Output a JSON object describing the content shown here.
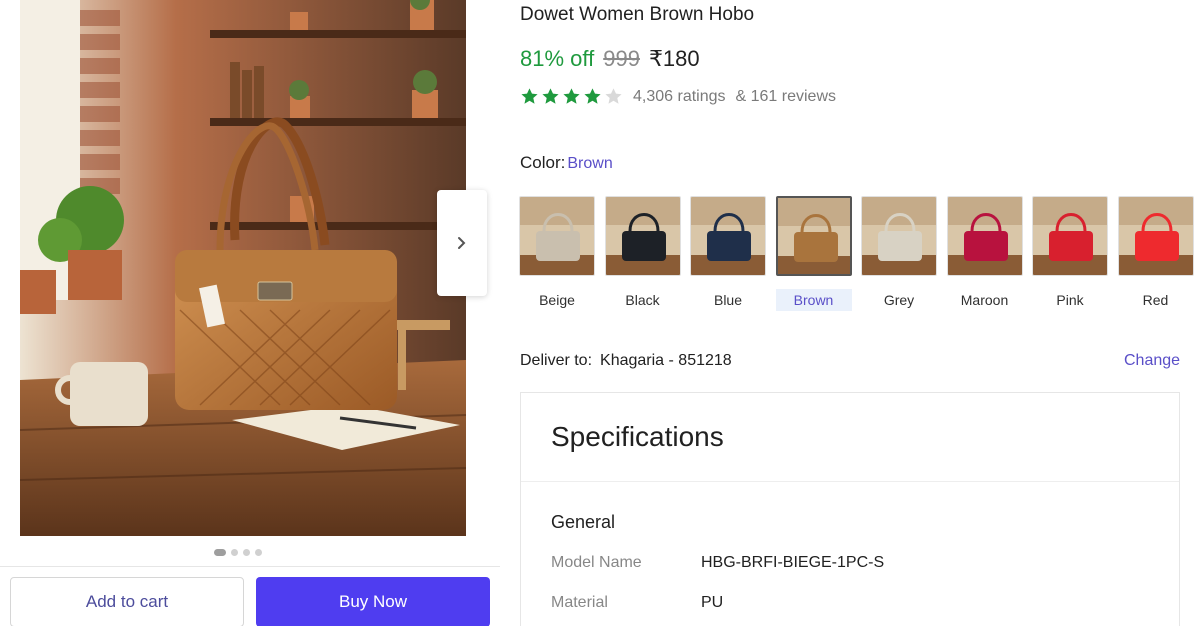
{
  "product": {
    "title": "Dowet Women Brown Hobo",
    "discount": "81% off",
    "mrp": "999",
    "price": "₹180",
    "rating_stars": 4,
    "ratings_text": "4,306 ratings",
    "reviews_text": "& 161 reviews"
  },
  "color": {
    "label": "Color:",
    "selected": "Brown",
    "swatches": [
      {
        "name": "Beige",
        "hex": "#c9bfae"
      },
      {
        "name": "Black",
        "hex": "#1d2127"
      },
      {
        "name": "Blue",
        "hex": "#1f2f4a"
      },
      {
        "name": "Brown",
        "hex": "#a9743d"
      },
      {
        "name": "Grey",
        "hex": "#d8d2c4"
      },
      {
        "name": "Maroon",
        "hex": "#b8123e"
      },
      {
        "name": "Pink",
        "hex": "#d8202e"
      },
      {
        "name": "Red",
        "hex": "#ee2a2e"
      }
    ]
  },
  "delivery": {
    "label": "Deliver to:",
    "location": "Khagaria - 851218",
    "change_label": "Change"
  },
  "specifications": {
    "title": "Specifications",
    "group": "General",
    "rows": [
      {
        "key": "Model Name",
        "value": "HBG-BRFI-BIEGE-1PC-S"
      },
      {
        "key": "Material",
        "value": "PU"
      }
    ]
  },
  "actions": {
    "add_to_cart": "Add to cart",
    "buy_now": "Buy Now"
  },
  "gallery": {
    "image_count": 4,
    "active_index": 0
  },
  "colors": {
    "discount_green": "#1f9a3e",
    "accent": "#4f3df0",
    "link": "#5a4fc8",
    "star_green": "#1f9a3e"
  },
  "icons": {
    "next": "chevron-right-icon",
    "star": "star-icon"
  }
}
